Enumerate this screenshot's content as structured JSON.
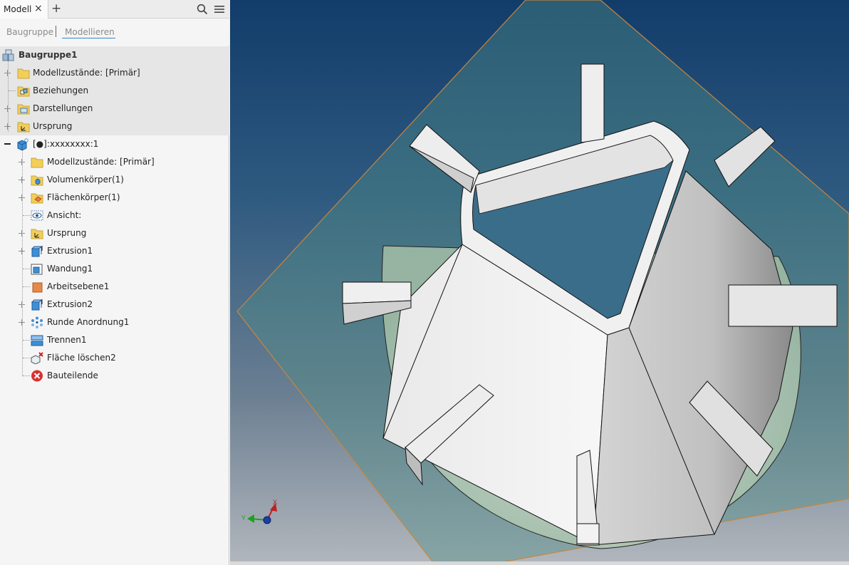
{
  "browser": {
    "tab_label": "Modell",
    "close_glyph": "×",
    "add_glyph": "+",
    "icons": [
      "search-icon",
      "menu-icon"
    ]
  },
  "subtabs": {
    "assembly": "Baugruppe",
    "modeling": "Modellieren"
  },
  "tree": {
    "root": {
      "label": "Baugruppe1",
      "icon": "assembly-icon"
    },
    "top_items": [
      {
        "label": "Modellzustände: [Primär]",
        "icon": "folder-icon"
      },
      {
        "label": "Beziehungen",
        "icon": "relationships-icon"
      },
      {
        "label": "Darstellungen",
        "icon": "representations-icon"
      },
      {
        "label": "Ursprung",
        "icon": "origin-icon"
      }
    ],
    "part": {
      "label": "[●]:xxxxxxxx:1",
      "icon": "part-icon"
    },
    "part_items": [
      {
        "label": "Modellzustände: [Primär]",
        "icon": "folder-icon"
      },
      {
        "label": "Volumenkörper(1)",
        "icon": "solid-bodies-icon"
      },
      {
        "label": "Flächenkörper(1)",
        "icon": "surface-bodies-icon"
      },
      {
        "label": "Ansicht:",
        "icon": "view-icon"
      },
      {
        "label": "Ursprung",
        "icon": "origin-icon"
      },
      {
        "label": "Extrusion1",
        "icon": "extrusion-icon"
      },
      {
        "label": "Wandung1",
        "icon": "shell-icon"
      },
      {
        "label": "Arbeitsebene1",
        "icon": "work-plane-icon"
      },
      {
        "label": "Extrusion2",
        "icon": "extrusion-icon"
      },
      {
        "label": "Runde Anordnung1",
        "icon": "circular-pattern-icon"
      },
      {
        "label": "Trennen1",
        "icon": "split-icon"
      },
      {
        "label": "Fläche löschen2",
        "icon": "delete-face-icon"
      },
      {
        "label": "Bauteilende",
        "icon": "end-of-part-icon"
      }
    ]
  },
  "triad": {
    "x_label": "X",
    "y_label": "Y"
  },
  "colors": {
    "accent": "#2a8bd1",
    "plane_edge": "#c9853c",
    "part": "#ededed"
  }
}
